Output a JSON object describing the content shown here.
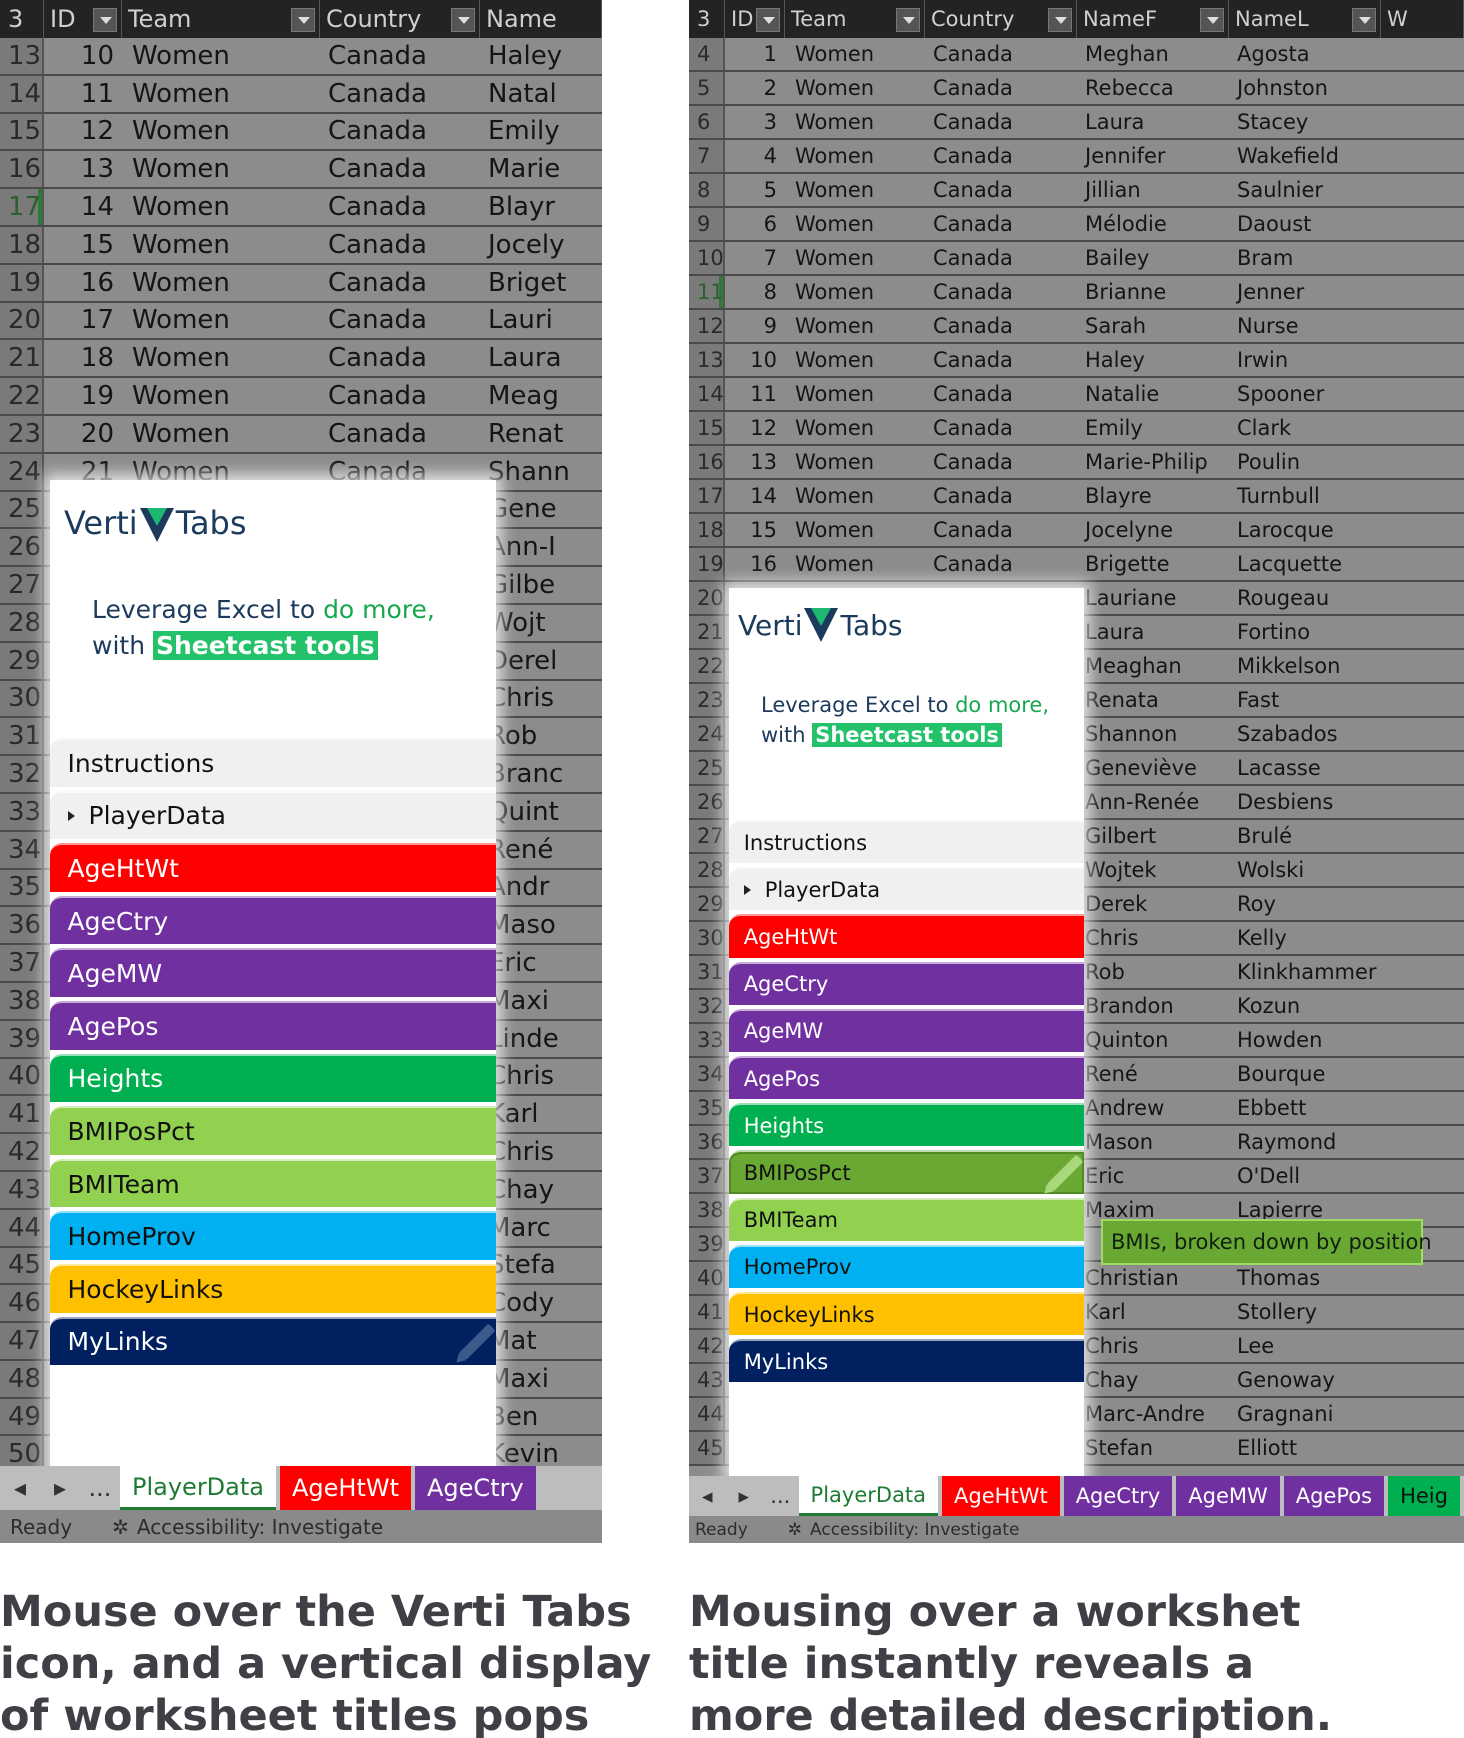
{
  "left_screenshot": {
    "headers": [
      {
        "label": "3"
      },
      {
        "label": "ID",
        "filter": "filter-icon"
      },
      {
        "label": "Team",
        "filter": "sort-filter-icon"
      },
      {
        "label": "Country",
        "filter": "filter-icon"
      },
      {
        "label": "Name"
      }
    ],
    "rows": [
      {
        "r": "13",
        "id": "10",
        "team": "Women",
        "country": "Canada",
        "name": "Haley"
      },
      {
        "r": "14",
        "id": "11",
        "team": "Women",
        "country": "Canada",
        "name": "Natal"
      },
      {
        "r": "15",
        "id": "12",
        "team": "Women",
        "country": "Canada",
        "name": "Emily"
      },
      {
        "r": "16",
        "id": "13",
        "team": "Women",
        "country": "Canada",
        "name": "Marie"
      },
      {
        "r": "17",
        "id": "14",
        "team": "Women",
        "country": "Canada",
        "name": "Blayr"
      },
      {
        "r": "18",
        "id": "15",
        "team": "Women",
        "country": "Canada",
        "name": "Jocely"
      },
      {
        "r": "19",
        "id": "16",
        "team": "Women",
        "country": "Canada",
        "name": "Briget"
      },
      {
        "r": "20",
        "id": "17",
        "team": "Women",
        "country": "Canada",
        "name": "Lauri"
      },
      {
        "r": "21",
        "id": "18",
        "team": "Women",
        "country": "Canada",
        "name": "Laura"
      },
      {
        "r": "22",
        "id": "19",
        "team": "Women",
        "country": "Canada",
        "name": "Meag"
      },
      {
        "r": "23",
        "id": "20",
        "team": "Women",
        "country": "Canada",
        "name": "Renat"
      },
      {
        "r": "24",
        "id": "21",
        "team": "Women",
        "country": "Canada",
        "name": "Shann"
      },
      {
        "r": "25",
        "id": "",
        "team": "",
        "country": "",
        "name": "Gene"
      },
      {
        "r": "26",
        "id": "",
        "team": "",
        "country": "",
        "name": "Ann-I"
      },
      {
        "r": "27",
        "id": "",
        "team": "",
        "country": "",
        "name": "Gilbe"
      },
      {
        "r": "28",
        "id": "",
        "team": "",
        "country": "",
        "name": "Wojt"
      },
      {
        "r": "29",
        "id": "",
        "team": "",
        "country": "",
        "name": "Derel"
      },
      {
        "r": "30",
        "id": "",
        "team": "",
        "country": "",
        "name": "Chris"
      },
      {
        "r": "31",
        "id": "",
        "team": "",
        "country": "",
        "name": "Rob"
      },
      {
        "r": "32",
        "id": "",
        "team": "",
        "country": "",
        "name": "Branc"
      },
      {
        "r": "33",
        "id": "",
        "team": "",
        "country": "",
        "name": "Quint"
      },
      {
        "r": "34",
        "id": "",
        "team": "",
        "country": "",
        "name": "René"
      },
      {
        "r": "35",
        "id": "",
        "team": "",
        "country": "",
        "name": "Andr"
      },
      {
        "r": "36",
        "id": "",
        "team": "",
        "country": "",
        "name": "Maso"
      },
      {
        "r": "37",
        "id": "",
        "team": "",
        "country": "",
        "name": "Eric"
      },
      {
        "r": "38",
        "id": "",
        "team": "",
        "country": "",
        "name": "Maxi"
      },
      {
        "r": "39",
        "id": "",
        "team": "",
        "country": "",
        "name": "Linde"
      },
      {
        "r": "40",
        "id": "",
        "team": "",
        "country": "",
        "name": "Chris"
      },
      {
        "r": "41",
        "id": "",
        "team": "",
        "country": "",
        "name": "Karl"
      },
      {
        "r": "42",
        "id": "",
        "team": "",
        "country": "",
        "name": "Chris"
      },
      {
        "r": "43",
        "id": "",
        "team": "",
        "country": "",
        "name": "Chay"
      },
      {
        "r": "44",
        "id": "",
        "team": "",
        "country": "",
        "name": "Marc"
      },
      {
        "r": "45",
        "id": "",
        "team": "",
        "country": "",
        "name": "Stefa"
      },
      {
        "r": "46",
        "id": "",
        "team": "",
        "country": "",
        "name": "Cody"
      },
      {
        "r": "47",
        "id": "",
        "team": "",
        "country": "",
        "name": "Mat"
      },
      {
        "r": "48",
        "id": "",
        "team": "",
        "country": "",
        "name": "Maxi"
      },
      {
        "r": "49",
        "id": "",
        "team": "",
        "country": "",
        "name": "Ben"
      },
      {
        "r": "50",
        "id": "",
        "team": "",
        "country": "",
        "name": "Kevin"
      }
    ],
    "popup": {
      "logo_left": "Verti",
      "logo_right": "Tabs",
      "tagline_1": "Leverage Excel to ",
      "tagline_1_green": "do more,",
      "tagline_2": "with ",
      "tagline_2_highlight": "Sheetcast tools",
      "tabs": [
        {
          "label": "Instructions",
          "bg": "#f0f0f0",
          "fg": "#111111"
        },
        {
          "label": "PlayerData",
          "bg": "#f0f0f0",
          "fg": "#111111",
          "arrow": "play-triangle-icon"
        },
        {
          "label": "AgeHtWt",
          "bg": "#ff0000",
          "fg": "#ffffff"
        },
        {
          "label": "AgeCtry",
          "bg": "#7030a0",
          "fg": "#ffffff"
        },
        {
          "label": "AgeMW",
          "bg": "#7030a0",
          "fg": "#ffffff"
        },
        {
          "label": "AgePos",
          "bg": "#7030a0",
          "fg": "#ffffff"
        },
        {
          "label": "Heights",
          "bg": "#00b050",
          "fg": "#ffffff"
        },
        {
          "label": "BMIPosPct",
          "bg": "#92d050",
          "fg": "#111111"
        },
        {
          "label": "BMITeam",
          "bg": "#92d050",
          "fg": "#111111"
        },
        {
          "label": "HomeProv",
          "bg": "#00b0f0",
          "fg": "#111111"
        },
        {
          "label": "HockeyLinks",
          "bg": "#ffc000",
          "fg": "#111111"
        },
        {
          "label": "MyLinks",
          "bg": "#002060",
          "fg": "#ffffff",
          "icon": "pencil-icon"
        }
      ]
    },
    "sheet_tabs": [
      {
        "label": "PlayerData",
        "bg": "#ffffff",
        "fg": "#1e7b34"
      },
      {
        "label": "AgeHtWt",
        "bg": "#ff0000",
        "fg": "#ffffff"
      },
      {
        "label": "AgeCtry",
        "bg": "#7030a0",
        "fg": "#ffffff"
      }
    ],
    "nav_prev": "◂",
    "nav_next": "▸",
    "nav_more": "...",
    "status_ready": "Ready",
    "status_accessibility": "Accessibility: Investigate"
  },
  "right_screenshot": {
    "headers": [
      {
        "label": "3"
      },
      {
        "label": "ID",
        "filter": "filter-icon"
      },
      {
        "label": "Team",
        "filter": "sort-filter-icon"
      },
      {
        "label": "Country",
        "filter": "filter-icon"
      },
      {
        "label": "NameF",
        "filter": "filter-icon"
      },
      {
        "label": "NameL",
        "filter": "filter-icon"
      },
      {
        "label": "W"
      }
    ],
    "rows": [
      {
        "r": "4",
        "id": "1",
        "team": "Women",
        "country": "Canada",
        "first": "Meghan",
        "last": "Agosta"
      },
      {
        "r": "5",
        "id": "2",
        "team": "Women",
        "country": "Canada",
        "first": "Rebecca",
        "last": "Johnston"
      },
      {
        "r": "6",
        "id": "3",
        "team": "Women",
        "country": "Canada",
        "first": "Laura",
        "last": "Stacey"
      },
      {
        "r": "7",
        "id": "4",
        "team": "Women",
        "country": "Canada",
        "first": "Jennifer",
        "last": "Wakefield"
      },
      {
        "r": "8",
        "id": "5",
        "team": "Women",
        "country": "Canada",
        "first": "Jillian",
        "last": "Saulnier"
      },
      {
        "r": "9",
        "id": "6",
        "team": "Women",
        "country": "Canada",
        "first": "Mélodie",
        "last": "Daoust"
      },
      {
        "r": "10",
        "id": "7",
        "team": "Women",
        "country": "Canada",
        "first": "Bailey",
        "last": "Bram"
      },
      {
        "r": "11",
        "id": "8",
        "team": "Women",
        "country": "Canada",
        "first": "Brianne",
        "last": "Jenner"
      },
      {
        "r": "12",
        "id": "9",
        "team": "Women",
        "country": "Canada",
        "first": "Sarah",
        "last": "Nurse"
      },
      {
        "r": "13",
        "id": "10",
        "team": "Women",
        "country": "Canada",
        "first": "Haley",
        "last": "Irwin"
      },
      {
        "r": "14",
        "id": "11",
        "team": "Women",
        "country": "Canada",
        "first": "Natalie",
        "last": "Spooner"
      },
      {
        "r": "15",
        "id": "12",
        "team": "Women",
        "country": "Canada",
        "first": "Emily",
        "last": "Clark"
      },
      {
        "r": "16",
        "id": "13",
        "team": "Women",
        "country": "Canada",
        "first": "Marie-Philip",
        "last": "Poulin"
      },
      {
        "r": "17",
        "id": "14",
        "team": "Women",
        "country": "Canada",
        "first": "Blayre",
        "last": "Turnbull"
      },
      {
        "r": "18",
        "id": "15",
        "team": "Women",
        "country": "Canada",
        "first": "Jocelyne",
        "last": "Larocque"
      },
      {
        "r": "19",
        "id": "16",
        "team": "Women",
        "country": "Canada",
        "first": "Brigette",
        "last": "Lacquette"
      },
      {
        "r": "20",
        "id": "",
        "team": "",
        "country": "",
        "first": "Lauriane",
        "last": "Rougeau"
      },
      {
        "r": "21",
        "id": "",
        "team": "",
        "country": "",
        "first": "Laura",
        "last": "Fortino"
      },
      {
        "r": "22",
        "id": "",
        "team": "",
        "country": "",
        "first": "Meaghan",
        "last": "Mikkelson"
      },
      {
        "r": "23",
        "id": "",
        "team": "",
        "country": "",
        "first": "Renata",
        "last": "Fast"
      },
      {
        "r": "24",
        "id": "",
        "team": "",
        "country": "",
        "first": "Shannon",
        "last": "Szabados"
      },
      {
        "r": "25",
        "id": "",
        "team": "",
        "country": "",
        "first": "Geneviève",
        "last": "Lacasse"
      },
      {
        "r": "26",
        "id": "",
        "team": "",
        "country": "",
        "first": "Ann-Renée",
        "last": "Desbiens"
      },
      {
        "r": "27",
        "id": "",
        "team": "",
        "country": "",
        "first": "Gilbert",
        "last": "Brulé"
      },
      {
        "r": "28",
        "id": "",
        "team": "",
        "country": "",
        "first": "Wojtek",
        "last": "Wolski"
      },
      {
        "r": "29",
        "id": "",
        "team": "",
        "country": "",
        "first": "Derek",
        "last": "Roy"
      },
      {
        "r": "30",
        "id": "",
        "team": "",
        "country": "",
        "first": "Chris",
        "last": "Kelly"
      },
      {
        "r": "31",
        "id": "",
        "team": "",
        "country": "",
        "first": "Rob",
        "last": "Klinkhammer"
      },
      {
        "r": "32",
        "id": "",
        "team": "",
        "country": "",
        "first": "Brandon",
        "last": "Kozun"
      },
      {
        "r": "33",
        "id": "",
        "team": "",
        "country": "",
        "first": "Quinton",
        "last": "Howden"
      },
      {
        "r": "34",
        "id": "",
        "team": "",
        "country": "",
        "first": "René",
        "last": "Bourque"
      },
      {
        "r": "35",
        "id": "",
        "team": "",
        "country": "",
        "first": "Andrew",
        "last": "Ebbett"
      },
      {
        "r": "36",
        "id": "",
        "team": "",
        "country": "",
        "first": "Mason",
        "last": "Raymond"
      },
      {
        "r": "37",
        "id": "",
        "team": "",
        "country": "",
        "first": "Eric",
        "last": "O'Dell"
      },
      {
        "r": "38",
        "id": "",
        "team": "",
        "country": "",
        "first": "Maxim",
        "last": "Lapierre"
      },
      {
        "r": "39",
        "id": "",
        "team": "",
        "country": "",
        "first": "",
        "last": ""
      },
      {
        "r": "40",
        "id": "",
        "team": "",
        "country": "",
        "first": "Christian",
        "last": "Thomas"
      },
      {
        "r": "41",
        "id": "",
        "team": "",
        "country": "",
        "first": "Karl",
        "last": "Stollery"
      },
      {
        "r": "42",
        "id": "",
        "team": "",
        "country": "",
        "first": "Chris",
        "last": "Lee"
      },
      {
        "r": "43",
        "id": "",
        "team": "",
        "country": "",
        "first": "Chay",
        "last": "Genoway"
      },
      {
        "r": "44",
        "id": "",
        "team": "",
        "country": "",
        "first": "Marc-Andre",
        "last": "Gragnani"
      },
      {
        "r": "45",
        "id": "",
        "team": "",
        "country": "",
        "first": "Stefan",
        "last": "Elliott"
      }
    ],
    "popup": {
      "logo_left": "Verti",
      "logo_right": "Tabs",
      "tagline_1": "Leverage Excel to ",
      "tagline_1_green": "do more,",
      "tagline_2": "with ",
      "tagline_2_highlight": "Sheetcast tools",
      "tabs": [
        {
          "label": "Instructions",
          "bg": "#f0f0f0",
          "fg": "#111111"
        },
        {
          "label": "PlayerData",
          "bg": "#f0f0f0",
          "fg": "#111111",
          "arrow": "play-triangle-icon"
        },
        {
          "label": "AgeHtWt",
          "bg": "#ff0000",
          "fg": "#ffffff"
        },
        {
          "label": "AgeCtry",
          "bg": "#7030a0",
          "fg": "#ffffff"
        },
        {
          "label": "AgeMW",
          "bg": "#7030a0",
          "fg": "#ffffff"
        },
        {
          "label": "AgePos",
          "bg": "#7030a0",
          "fg": "#ffffff"
        },
        {
          "label": "Heights",
          "bg": "#00b050",
          "fg": "#ffffff"
        },
        {
          "label": "BMIPosPct",
          "bg": "#6aa834",
          "fg": "#111111",
          "icon": "pencil-icon",
          "hovered": true
        },
        {
          "label": "BMITeam",
          "bg": "#92d050",
          "fg": "#111111"
        },
        {
          "label": "HomeProv",
          "bg": "#00b0f0",
          "fg": "#111111"
        },
        {
          "label": "HockeyLinks",
          "bg": "#ffc000",
          "fg": "#111111"
        },
        {
          "label": "MyLinks",
          "bg": "#002060",
          "fg": "#ffffff"
        }
      ],
      "tooltip": "BMIs, broken down by position"
    },
    "sheet_tabs": [
      {
        "label": "PlayerData",
        "bg": "#ffffff",
        "fg": "#1e7b34"
      },
      {
        "label": "AgeHtWt",
        "bg": "#ff0000",
        "fg": "#ffffff"
      },
      {
        "label": "AgeCtry",
        "bg": "#7030a0",
        "fg": "#ffffff"
      },
      {
        "label": "AgeMW",
        "bg": "#7030a0",
        "fg": "#ffffff"
      },
      {
        "label": "AgePos",
        "bg": "#7030a0",
        "fg": "#ffffff"
      },
      {
        "label": "Heig",
        "bg": "#00b050",
        "fg": "#111111"
      }
    ],
    "nav_prev": "◂",
    "nav_next": "▸",
    "nav_more": "...",
    "status_ready": "Ready",
    "status_accessibility": "Accessibility: Investigate"
  },
  "captions": {
    "left": "Mouse over the Verti Tabs icon, and a vertical display of worksheet titles pops up.",
    "right": "Mousing over a workshet title instantly reveals a more detailed description."
  },
  "colors": {
    "accent_green": "#17a84f",
    "brand_navy": "#1b3a5c",
    "excel_green": "#1e7b34"
  }
}
